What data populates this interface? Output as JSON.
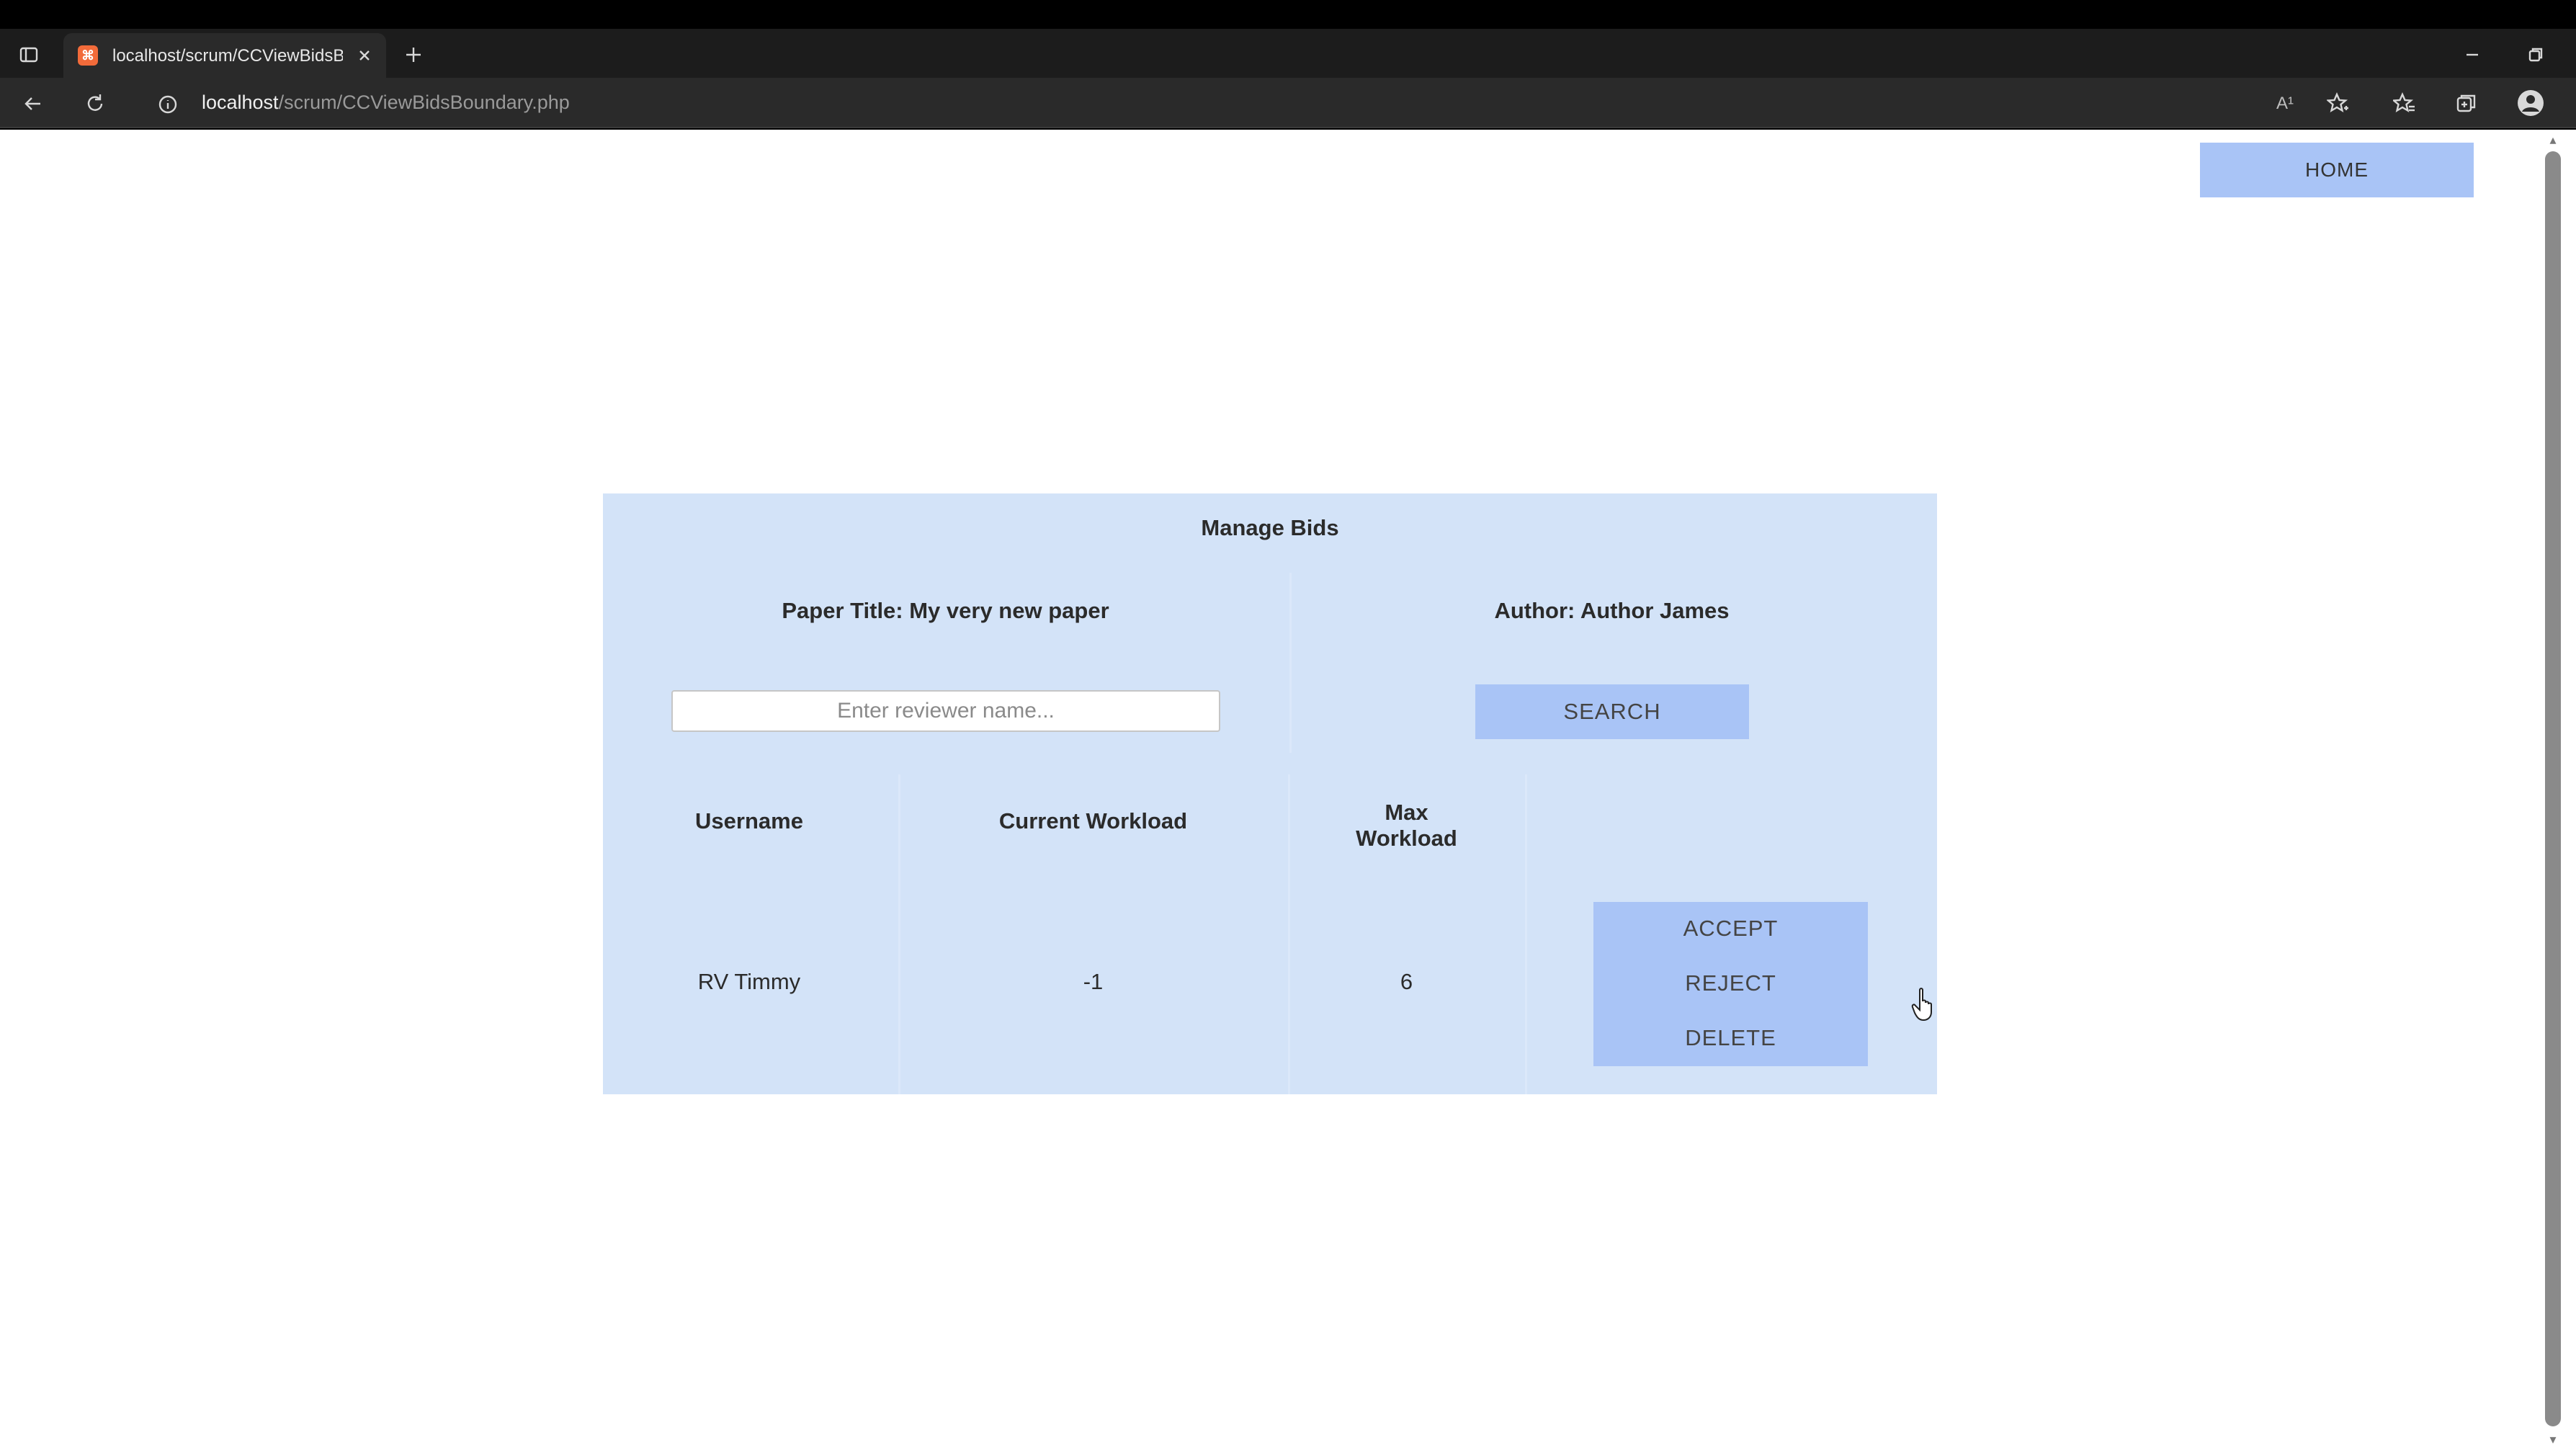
{
  "browser": {
    "tab_title": "localhost/scrum/CCViewBidsBou",
    "favicon_glyph": "⌘",
    "url_host": "localhost",
    "url_path": "/scrum/CCViewBidsBoundary.php",
    "read_aloud_glyph": "A¹"
  },
  "page": {
    "home_label": "HOME"
  },
  "panel": {
    "title": "Manage Bids",
    "paper_title": "Paper Title: My very new paper",
    "author": "Author: Author James",
    "search_placeholder": "Enter reviewer name...",
    "search_value": "",
    "search_label": "SEARCH"
  },
  "table": {
    "headers": {
      "username": "Username",
      "current_workload": "Current Workload",
      "max_workload_line1": "Max",
      "max_workload_line2": "Workload"
    },
    "rows": [
      {
        "username": "RV Timmy",
        "current_workload": "-1",
        "max_workload": "6",
        "actions": {
          "accept": "ACCEPT",
          "reject": "REJECT",
          "delete": "DELETE"
        }
      }
    ]
  },
  "colors": {
    "panel_bg": "#d3e3f8",
    "button_bg": "#a9c4f6",
    "favicon": "#f26b3a"
  }
}
